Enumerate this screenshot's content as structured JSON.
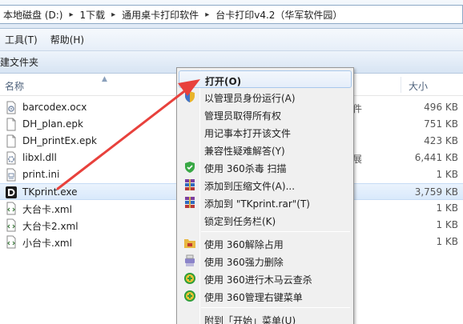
{
  "address": {
    "crumbs": [
      "本地磁盘 (D:)",
      "1下载",
      "通用桌卡打印软件",
      "台卡打印v4.2（华军软件园）"
    ]
  },
  "menubar": {
    "tools": "工具(T)",
    "help": "帮助(H)"
  },
  "toolbar": {
    "new_folder": "建文件夹"
  },
  "columns": {
    "name": "名称",
    "size": "大小"
  },
  "files": [
    {
      "name": "barcodex.ocx",
      "type": "件",
      "size": "496 KB",
      "icon": "ocx-icon"
    },
    {
      "name": "DH_plan.epk",
      "type": "",
      "size": "751 KB",
      "icon": "file-icon"
    },
    {
      "name": "DH_printEx.epk",
      "type": "",
      "size": "423 KB",
      "icon": "file-icon"
    },
    {
      "name": "libxl.dll",
      "type": "展",
      "size": "6,441 KB",
      "icon": "dll-icon"
    },
    {
      "name": "print.ini",
      "type": "",
      "size": "1 KB",
      "icon": "ini-icon"
    },
    {
      "name": "TKprint.exe",
      "type": "",
      "size": "3,759 KB",
      "icon": "tkprint-app-icon",
      "selected": true
    },
    {
      "name": "大台卡.xml",
      "type": "",
      "size": "1 KB",
      "icon": "xml-icon"
    },
    {
      "name": "大台卡2.xml",
      "type": "",
      "size": "1 KB",
      "icon": "xml-icon"
    },
    {
      "name": "小台卡.xml",
      "type": "",
      "size": "1 KB",
      "icon": "xml-icon"
    }
  ],
  "context_menu": {
    "open": "打开(O)",
    "run_as_admin": "以管理员身份运行(A)",
    "take_ownership": "管理员取得所有权",
    "open_notepad": "用记事本打开该文件",
    "compat_troubleshoot": "兼容性疑难解答(Y)",
    "scan_360": "使用 360杀毒 扫描",
    "add_to_archive": "添加到压缩文件(A)...",
    "add_to_rar": "添加到 \"TKprint.rar\"(T)",
    "pin_taskbar": "锁定到任务栏(K)",
    "unlock_360": "使用 360解除占用",
    "force_delete_360": "使用 360强力删除",
    "trojan_scan_360": "使用 360进行木马云查杀",
    "manage_rightclick_360": "使用 360管理右键菜单",
    "pin_start": "附到「开始」菜单(U)"
  },
  "colors": {
    "arrow": "#e8413c",
    "selection": "#d9e9fb",
    "menu_bg": "#f0f0f0"
  }
}
